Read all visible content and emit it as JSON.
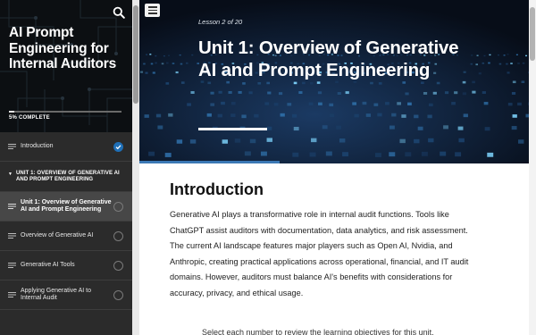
{
  "course": {
    "title": "AI Prompt Engineering for Internal Auditors",
    "progress_label": "5% COMPLETE",
    "progress_fraction": 0.05
  },
  "sidebar": {
    "search_icon": "search-icon",
    "items": [
      {
        "label": "Introduction",
        "status": "complete"
      }
    ],
    "section": {
      "label": "UNIT 1: OVERVIEW OF GENERATIVE AI AND PROMPT ENGINEERING"
    },
    "lessons": [
      {
        "label": "Unit 1: Overview of Generative AI and Prompt Engineering",
        "active": true
      },
      {
        "label": "Overview of Generative AI"
      },
      {
        "label": "Generative AI Tools"
      },
      {
        "label": "Applying Generative AI to Internal Audit"
      }
    ]
  },
  "hero": {
    "lesson_count": "Lesson 2 of 20",
    "title": "Unit 1: Overview of Generative AI and Prompt Engineering",
    "menu_icon": "hamburger-menu-icon"
  },
  "content": {
    "heading": "Introduction",
    "paragraph": "Generative AI plays a transformative role in internal audit functions. Tools like ChatGPT assist auditors with documentation, data analytics, and risk assessment. The current AI landscape features major players such as Open AI, Nvidia, and Anthropic, creating practical applications across operational, financial, and IT audit domains. However, auditors must balance AI's benefits with considerations for accuracy, privacy, and ethical usage.",
    "next_line": "Select each number to review the learning objectives for this unit."
  },
  "colors": {
    "accent": "#1f6fb6",
    "sidebar_bg": "#2b2b2b",
    "hero_bg": "#0a1322"
  }
}
